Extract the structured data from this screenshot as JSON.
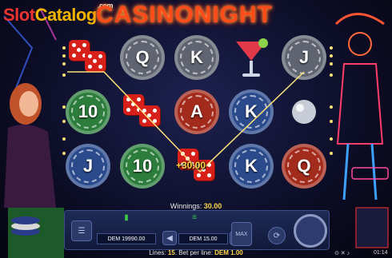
{
  "logo": {
    "slot": "Slot",
    "catalog": "Catalog",
    "com": ".com"
  },
  "title": "CASINONIGHT",
  "reels": [
    [
      {
        "t": "dice"
      },
      {
        "t": "chip",
        "c": "green",
        "s": "10"
      },
      {
        "t": "chip",
        "c": "blue",
        "s": "J"
      }
    ],
    [
      {
        "t": "chip",
        "c": "grey",
        "s": "Q"
      },
      {
        "t": "dice"
      },
      {
        "t": "chip",
        "c": "green",
        "s": "10"
      }
    ],
    [
      {
        "t": "chip",
        "c": "grey",
        "s": "K"
      },
      {
        "t": "chip",
        "c": "red",
        "s": "A"
      },
      {
        "t": "dice"
      }
    ],
    [
      {
        "t": "cocktail"
      },
      {
        "t": "chip",
        "c": "blue",
        "s": "K"
      },
      {
        "t": "chip",
        "c": "blue",
        "s": "K"
      }
    ],
    [
      {
        "t": "chip",
        "c": "grey",
        "s": "J"
      },
      {
        "t": "ball"
      },
      {
        "t": "chip",
        "c": "red",
        "s": "Q"
      }
    ]
  ],
  "win_label": "+30.00",
  "winnings": {
    "label": "Winnings:",
    "value": "30.00"
  },
  "panel": {
    "balance": "DEM 19990.00",
    "bet": "DEM 15.00",
    "max": "MAX"
  },
  "status": {
    "lines_label": "Lines:",
    "lines": "15",
    "bet_label": "Bet per line:",
    "bet": "DEM 1.00"
  },
  "clock": "01:14",
  "colors": {
    "accent": "#ffd84a",
    "neon": "#ff4a1a"
  }
}
